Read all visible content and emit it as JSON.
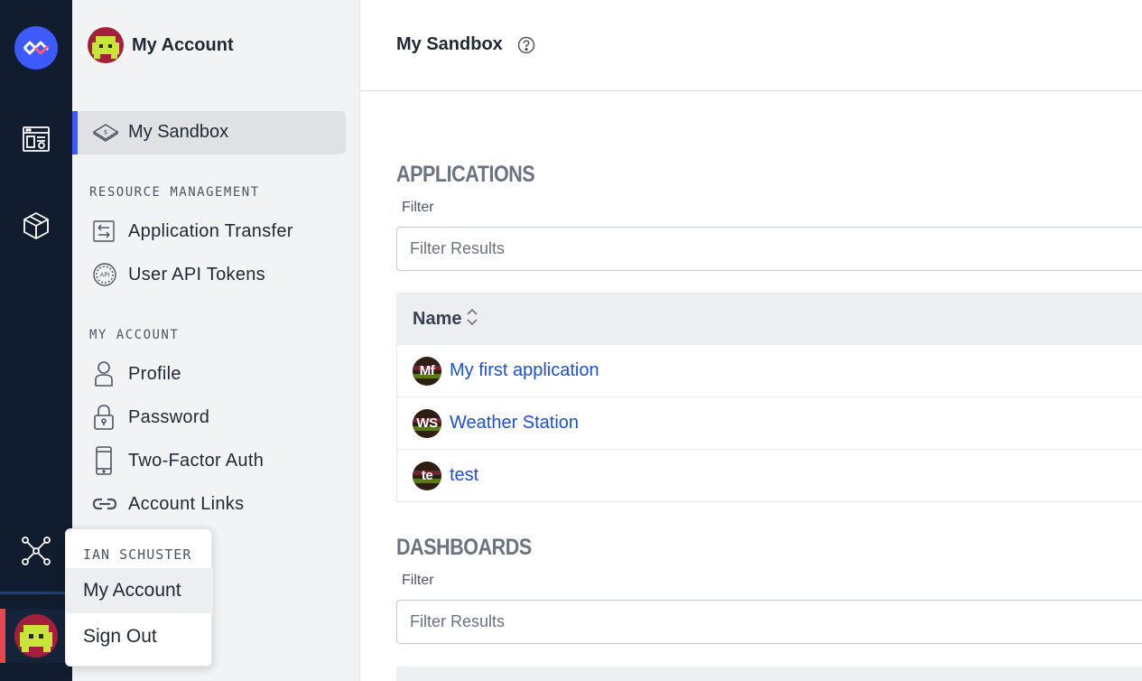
{
  "sidebar": {
    "title": "My Account",
    "sandbox_label": "My Sandbox",
    "sections": [
      {
        "title": "RESOURCE MANAGEMENT",
        "items": [
          {
            "label": "Application Transfer",
            "icon": "transfer-icon"
          },
          {
            "label": "User API Tokens",
            "icon": "api-icon"
          }
        ]
      },
      {
        "title": "MY ACCOUNT",
        "items": [
          {
            "label": "Profile",
            "icon": "person-icon"
          },
          {
            "label": "Password",
            "icon": "lock-icon"
          },
          {
            "label": "Two-Factor Auth",
            "icon": "phone-icon"
          },
          {
            "label": "Account Links",
            "icon": "link-icon"
          }
        ]
      }
    ]
  },
  "user_menu": {
    "username": "IAN SCHUSTER",
    "items": [
      "My Account",
      "Sign Out"
    ]
  },
  "header": {
    "title": "My Sandbox"
  },
  "applications": {
    "title": "APPLICATIONS",
    "filter_label": "Filter",
    "filter_placeholder": "Filter Results",
    "column_name": "Name",
    "rows": [
      {
        "initials": "Mf",
        "name": "My first application"
      },
      {
        "initials": "WS",
        "name": "Weather Station"
      },
      {
        "initials": "te",
        "name": "test"
      }
    ]
  },
  "dashboards": {
    "title": "DASHBOARDS",
    "filter_label": "Filter",
    "filter_placeholder": "Filter Results"
  },
  "colors": {
    "rail_bg": "#111d2e",
    "accent": "#3d5afe",
    "link": "#1d4ed8",
    "avatar_red": "#a31f3b",
    "avatar_green": "#c8e63a"
  }
}
